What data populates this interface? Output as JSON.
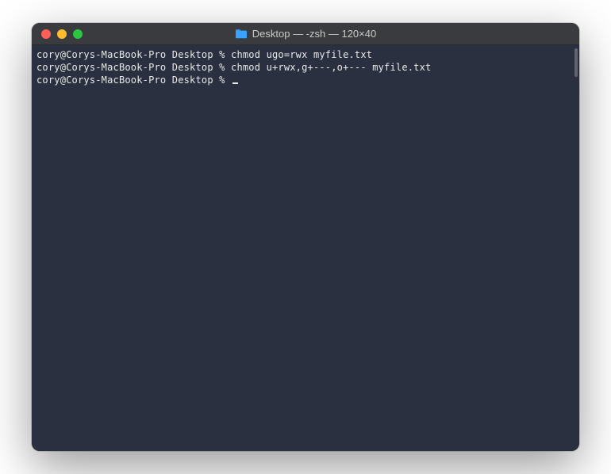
{
  "window": {
    "title": "Desktop — -zsh — 120×40"
  },
  "terminal": {
    "lines": [
      {
        "prompt": "cory@Corys-MacBook-Pro Desktop % ",
        "command": "chmod ugo=rwx myfile.txt"
      },
      {
        "prompt": "cory@Corys-MacBook-Pro Desktop % ",
        "command": "chmod u+rwx,g+---,o+--- myfile.txt"
      },
      {
        "prompt": "cory@Corys-MacBook-Pro Desktop % ",
        "command": ""
      }
    ]
  }
}
